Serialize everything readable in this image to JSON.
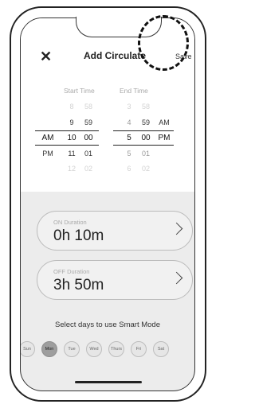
{
  "header": {
    "close_icon": "close-icon",
    "title": "Add Circulate",
    "save_label": "Save"
  },
  "picker": {
    "start_label": "Start Time",
    "end_label": "End Time",
    "ampm_left": [
      "AM",
      "PM"
    ],
    "start_hours": [
      "8",
      "9",
      "10",
      "11",
      "12"
    ],
    "start_minutes": [
      "58",
      "59",
      "00",
      "01",
      "02"
    ],
    "end_hours": [
      "3",
      "4",
      "5",
      "5",
      "6"
    ],
    "end_minutes": [
      "58",
      "59",
      "00",
      "01",
      "02"
    ],
    "ampm_right": [
      "AM",
      "PM"
    ]
  },
  "on_duration": {
    "label": "ON Duration",
    "value": "0h 10m"
  },
  "off_duration": {
    "label": "OFF Duration",
    "value": "3h 50m"
  },
  "days": {
    "prompt": "Select days to use Smart Mode",
    "items": [
      "Sun",
      "Mon",
      "Tue",
      "Wed",
      "Thurs",
      "Fri",
      "Sat"
    ],
    "selected": "Mon"
  },
  "colors": {
    "selected_day": "#9e9e9e",
    "background": "#ececec",
    "card": "#f1f1f1"
  }
}
